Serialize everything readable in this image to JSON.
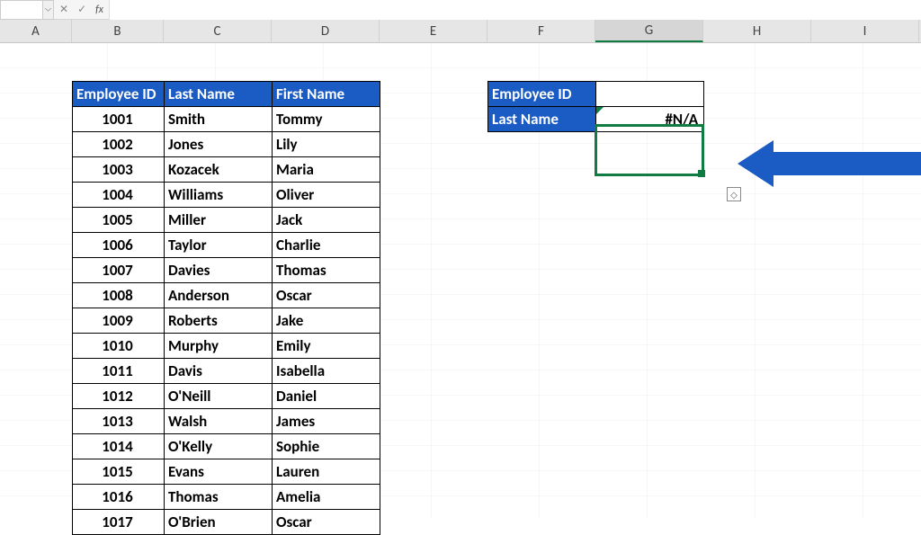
{
  "formula_bar": {
    "name_box": "",
    "formula": ""
  },
  "columns": [
    "A",
    "B",
    "C",
    "D",
    "E",
    "F",
    "G",
    "H",
    "I"
  ],
  "selected_column": "G",
  "data_table": {
    "headers": [
      "Employee ID",
      "Last Name",
      "First Name"
    ],
    "rows": [
      {
        "id": "1001",
        "last": "Smith",
        "first": "Tommy"
      },
      {
        "id": "1002",
        "last": "Jones",
        "first": "Lily"
      },
      {
        "id": "1003",
        "last": "Kozacek",
        "first": "Maria"
      },
      {
        "id": "1004",
        "last": "Williams",
        "first": "Oliver"
      },
      {
        "id": "1005",
        "last": "Miller",
        "first": "Jack"
      },
      {
        "id": "1006",
        "last": "Taylor",
        "first": "Charlie"
      },
      {
        "id": "1007",
        "last": "Davies",
        "first": "Thomas"
      },
      {
        "id": "1008",
        "last": "Anderson",
        "first": "Oscar"
      },
      {
        "id": "1009",
        "last": "Roberts",
        "first": "Jake"
      },
      {
        "id": "1010",
        "last": "Murphy",
        "first": "Emily"
      },
      {
        "id": "1011",
        "last": "Davis",
        "first": "Isabella"
      },
      {
        "id": "1012",
        "last": "O'Neill",
        "first": "Daniel"
      },
      {
        "id": "1013",
        "last": "Walsh",
        "first": "James"
      },
      {
        "id": "1014",
        "last": "O'Kelly",
        "first": "Sophie"
      },
      {
        "id": "1015",
        "last": "Evans",
        "first": "Lauren"
      },
      {
        "id": "1016",
        "last": "Thomas",
        "first": "Amelia"
      },
      {
        "id": "1017",
        "last": "O'Brien",
        "first": "Oscar"
      }
    ]
  },
  "lookup": {
    "rows": [
      {
        "label": "Employee ID",
        "value": ""
      },
      {
        "label": "Last Name",
        "value": "#N/A"
      }
    ]
  },
  "colors": {
    "accent": "#1a5bc4",
    "selection": "#107c41"
  }
}
